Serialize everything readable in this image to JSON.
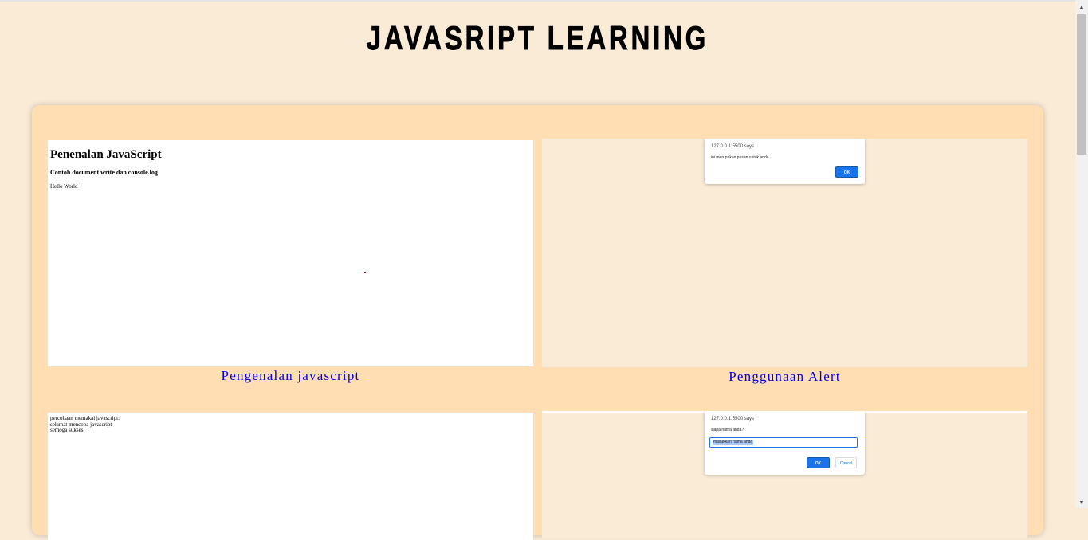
{
  "page": {
    "title": "JAVASRIPT LEARNING"
  },
  "cards": [
    {
      "caption": "Pengenalan javascript",
      "preview": {
        "heading": "Penenalan JavaScript",
        "subheading": "Contoh document.write dan console.log",
        "text": "Hello World"
      }
    },
    {
      "caption": "Penggunaan Alert",
      "preview": {
        "origin": "127.0.0.1:5500 says",
        "message": "ini merupakan pesan untuk anda",
        "ok_label": "OK"
      }
    },
    {
      "preview": {
        "lines": [
          "percobaan memakai javascript:",
          "selamat mencoba javascript",
          "semoga sukses!"
        ]
      }
    },
    {
      "preview": {
        "origin": "127.0.0.1:5500 says",
        "message": "siapa nama anda?",
        "input_value": "masukkan nama anda",
        "ok_label": "OK",
        "cancel_label": "Cancel"
      }
    }
  ],
  "colors": {
    "background": "#faebd7",
    "card": "#ffdeb4",
    "link": "#0000ee",
    "accent": "#1a73e8"
  },
  "scrollbar": {
    "up_icon": "arrow-up-icon",
    "down_icon": "arrow-down-icon"
  }
}
